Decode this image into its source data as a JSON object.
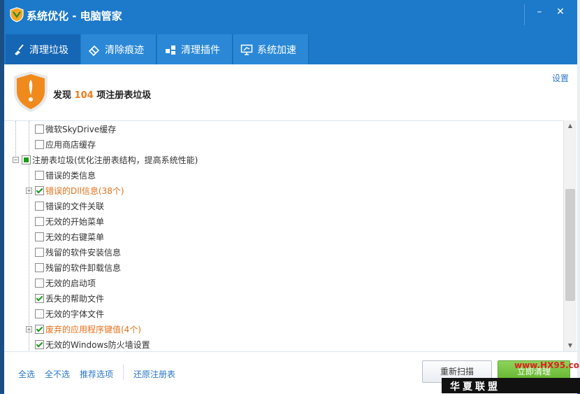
{
  "window": {
    "title": "系统优化 - 电脑管家",
    "minimize_glyph": "–",
    "close_glyph": "✕"
  },
  "tabs": [
    {
      "label": "清理垃圾",
      "icon": "broom-icon",
      "active": true
    },
    {
      "label": "清除痕迹",
      "icon": "eraser-icon",
      "active": false
    },
    {
      "label": "清理插件",
      "icon": "plugin-icon",
      "active": false
    },
    {
      "label": "系统加速",
      "icon": "monitor-speed-icon",
      "active": false
    }
  ],
  "header": {
    "found_prefix": "发现",
    "found_count": "104",
    "found_suffix": "项注册表垃圾",
    "settings_label": "设置"
  },
  "tree": [
    {
      "label": "微软SkyDrive缓存",
      "checked": false,
      "level": 2
    },
    {
      "label": "应用商店缓存",
      "checked": false,
      "level": 2
    },
    {
      "label": "注册表垃圾(优化注册表结构，提高系统性能)",
      "checked": "partial",
      "level": 1,
      "expander": "−"
    },
    {
      "label": "错误的类信息",
      "checked": false,
      "level": 2
    },
    {
      "label": "错误的Dll信息(38个)",
      "checked": true,
      "level": 2,
      "expander": "+",
      "highlight": true
    },
    {
      "label": "错误的文件关联",
      "checked": false,
      "level": 2
    },
    {
      "label": "无效的开始菜单",
      "checked": false,
      "level": 2
    },
    {
      "label": "无效的右键菜单",
      "checked": false,
      "level": 2
    },
    {
      "label": "残留的软件安装信息",
      "checked": false,
      "level": 2
    },
    {
      "label": "残留的软件卸载信息",
      "checked": false,
      "level": 2
    },
    {
      "label": "无效的启动项",
      "checked": false,
      "level": 2
    },
    {
      "label": "丢失的帮助文件",
      "checked": true,
      "level": 2
    },
    {
      "label": "无效的字体文件",
      "checked": false,
      "level": 2
    },
    {
      "label": "废弃的应用程序键值(4个)",
      "checked": true,
      "level": 2,
      "expander": "+",
      "highlight": true
    },
    {
      "label": "无效的Windows防火墙设置",
      "checked": true,
      "level": 2
    }
  ],
  "footer": {
    "select_all": "全选",
    "select_none": "全不选",
    "recommended": "推荐选项",
    "restore_registry": "还原注册表",
    "rescan_label": "重新扫描",
    "clean_label": "立即清理"
  },
  "watermark": {
    "text": "华夏联盟",
    "url": "www.HX95.com"
  },
  "colors": {
    "brand_blue": "#1d79c9",
    "highlight_orange": "#e6711b",
    "link_blue": "#2b78c8",
    "check_green": "#1a9b1a"
  }
}
